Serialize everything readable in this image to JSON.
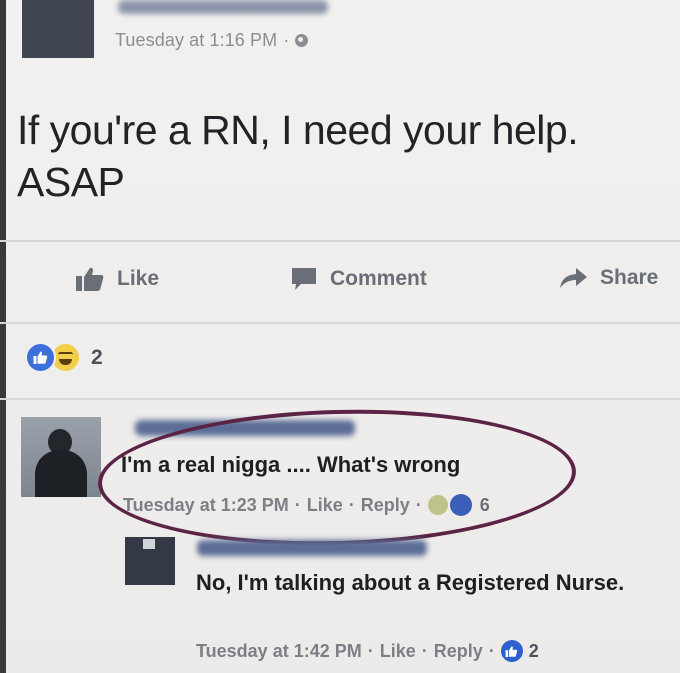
{
  "post": {
    "time": "Tuesday at 1:16 PM",
    "separator": "·",
    "text_line1": "If you're a RN, I need your help.",
    "text_line2": "ASAP"
  },
  "actions": {
    "like": "Like",
    "comment": "Comment",
    "share": "Share"
  },
  "reactions": {
    "icons": [
      "like-icon",
      "haha-icon"
    ],
    "count": "2"
  },
  "comments": [
    {
      "text": "I'm a real nigga .... What's wrong",
      "time": "Tuesday at 1:23 PM",
      "like": "Like",
      "reply": "Reply",
      "reaction_count": "6"
    },
    {
      "text": "No, I'm talking about a Registered Nurse.",
      "time": "Tuesday at 1:42 PM",
      "like": "Like",
      "reply": "Reply",
      "reaction_count": "2"
    }
  ],
  "colors": {
    "background": "#f1efed",
    "like_blue": "#3d6fdc",
    "annotation_circle": "#5b2345"
  }
}
